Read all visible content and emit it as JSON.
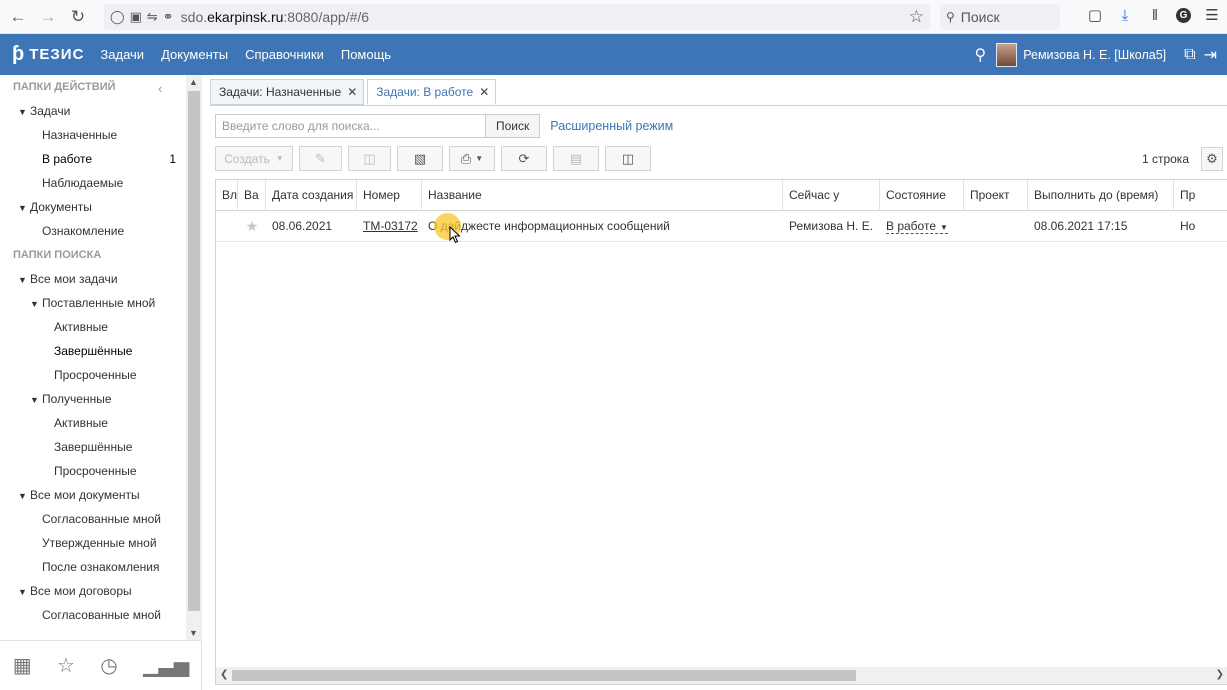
{
  "browser": {
    "url_prefix": "sdo.",
    "url_domain": "ekarpinsk.ru",
    "url_suffix": ":8080/app/#/6",
    "search_placeholder": "Поиск"
  },
  "header": {
    "logo": "ТЕЗИС",
    "menu": [
      "Задачи",
      "Документы",
      "Справочники",
      "Помощь"
    ],
    "user": "Ремизова Н. Е. [Школа5]"
  },
  "sidebar": {
    "action_folders_title": "ПАПКИ ДЕЙСТВИЙ",
    "search_folders_title": "ПАПКИ ПОИСКА",
    "action_items": [
      {
        "label": "Задачи",
        "count": ""
      },
      {
        "label": "Назначенные",
        "count": ""
      },
      {
        "label": "В работе",
        "count": "1"
      },
      {
        "label": "Наблюдаемые",
        "count": ""
      },
      {
        "label": "Документы",
        "count": ""
      },
      {
        "label": "Ознакомление",
        "count": ""
      }
    ],
    "search_items": [
      "Все мои задачи",
      "Поставленные мной",
      "Активные",
      "Завершённые",
      "Просроченные",
      "Полученные",
      "Активные",
      "Завершённые",
      "Просроченные",
      "Все мои документы",
      "Согласованные мной",
      "Утвержденные мной",
      "После ознакомления",
      "Все мои договоры",
      "Согласованные мной"
    ]
  },
  "tabs": [
    {
      "label": "Задачи: Назначенные"
    },
    {
      "label": "Задачи: В работе"
    }
  ],
  "search": {
    "placeholder": "Введите слово для поиска...",
    "button": "Поиск",
    "advanced": "Расширенный режим"
  },
  "toolbar": {
    "create": "Создать",
    "row_count": "1 строка"
  },
  "table": {
    "columns": [
      "Вл",
      "Ва",
      "Дата создания",
      "Номер",
      "Название",
      "Сейчас у",
      "Состояние",
      "Проект",
      "Выполнить до (время)",
      "Пр"
    ],
    "rows": [
      {
        "date": "08.06.2021",
        "number": "ТМ-03172",
        "name": "О дайджесте информационных сообщений",
        "assignee": "Ремизова Н. Е.",
        "state": "В работе",
        "project": "",
        "due": "08.06.2021 17:15",
        "priority": "Но"
      }
    ]
  },
  "colors": {
    "header_bg": "#3d75b6",
    "link": "#3d75b6",
    "cursor_highlight": "#f8c828"
  }
}
